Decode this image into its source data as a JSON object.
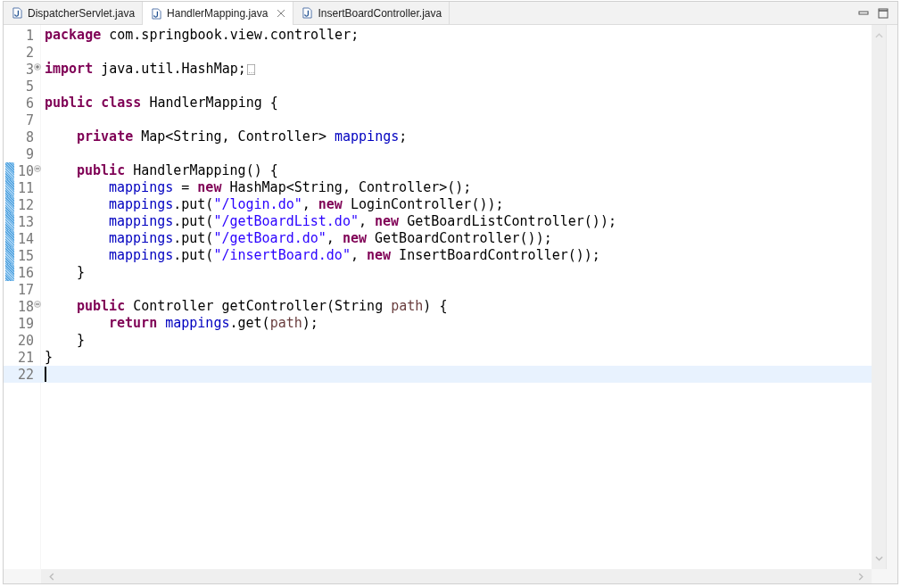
{
  "tabs": [
    {
      "label": "DispatcherServlet.java",
      "selected": false
    },
    {
      "label": "HandlerMapping.java",
      "selected": true
    },
    {
      "label": "InsertBoardController.java",
      "selected": false
    }
  ],
  "lines": [
    {
      "number": "1",
      "changed": false,
      "current": false,
      "tokens": [
        {
          "kind": "kw",
          "text": "package"
        },
        {
          "kind": "plain",
          "text": " com.springbook.view.controller;"
        }
      ]
    },
    {
      "number": "2",
      "changed": false,
      "current": false
    },
    {
      "number": "3",
      "changed": false,
      "current": false,
      "fold": {
        "collapsed": true
      },
      "tokens": [
        {
          "kind": "kw",
          "text": "import"
        },
        {
          "kind": "plain",
          "text": " java.util.HashMap;"
        }
      ]
    },
    {
      "number": "5",
      "changed": false,
      "current": false
    },
    {
      "number": "6",
      "changed": false,
      "current": false,
      "tokens": [
        {
          "kind": "kw",
          "text": "public class"
        },
        {
          "kind": "plain",
          "text": " HandlerMapping {"
        }
      ],
      "children": [
        {
          "number": "7",
          "changed": false,
          "current": false
        },
        {
          "number": "8",
          "changed": false,
          "current": false,
          "tokens": [
            {
              "kind": "kw",
              "text": "private"
            },
            {
              "kind": "plain",
              "text": " Map<String, Controller> "
            },
            {
              "kind": "field",
              "text": "mappings"
            },
            {
              "kind": "plain",
              "text": ";"
            }
          ]
        },
        {
          "number": "9",
          "changed": false,
          "current": false
        },
        {
          "number": "10",
          "changed": true,
          "current": false,
          "fold": {
            "collapsed": false
          },
          "tokens": [
            {
              "kind": "kw",
              "text": "public"
            },
            {
              "kind": "plain",
              "text": " HandlerMapping() {"
            }
          ],
          "children": [
            {
              "number": "11",
              "changed": true,
              "current": false,
              "tokens": [
                {
                  "kind": "field",
                  "text": "mappings"
                },
                {
                  "kind": "plain",
                  "text": " = "
                },
                {
                  "kind": "kw",
                  "text": "new"
                },
                {
                  "kind": "plain",
                  "text": " HashMap<String, Controller>();"
                }
              ]
            },
            {
              "number": "12",
              "changed": true,
              "current": false,
              "tokens": [
                {
                  "kind": "field",
                  "text": "mappings"
                },
                {
                  "kind": "plain",
                  "text": ".put("
                },
                {
                  "kind": "str",
                  "text": "\"/login.do\""
                },
                {
                  "kind": "plain",
                  "text": ", "
                },
                {
                  "kind": "kw",
                  "text": "new"
                },
                {
                  "kind": "plain",
                  "text": " LoginController());"
                }
              ]
            },
            {
              "number": "13",
              "changed": true,
              "current": false,
              "tokens": [
                {
                  "kind": "field",
                  "text": "mappings"
                },
                {
                  "kind": "plain",
                  "text": ".put("
                },
                {
                  "kind": "str",
                  "text": "\"/getBoardList.do\""
                },
                {
                  "kind": "plain",
                  "text": ", "
                },
                {
                  "kind": "kw",
                  "text": "new"
                },
                {
                  "kind": "plain",
                  "text": " GetBoardListController());"
                }
              ]
            },
            {
              "number": "14",
              "changed": true,
              "current": false,
              "tokens": [
                {
                  "kind": "field",
                  "text": "mappings"
                },
                {
                  "kind": "plain",
                  "text": ".put("
                },
                {
                  "kind": "str",
                  "text": "\"/getBoard.do\""
                },
                {
                  "kind": "plain",
                  "text": ", "
                },
                {
                  "kind": "kw",
                  "text": "new"
                },
                {
                  "kind": "plain",
                  "text": " GetBoardController());"
                }
              ]
            },
            {
              "number": "15",
              "changed": true,
              "current": false,
              "tokens": [
                {
                  "kind": "field",
                  "text": "mappings"
                },
                {
                  "kind": "plain",
                  "text": ".put("
                },
                {
                  "kind": "str",
                  "text": "\"/insertBoard.do\""
                },
                {
                  "kind": "plain",
                  "text": ", "
                },
                {
                  "kind": "kw",
                  "text": "new"
                },
                {
                  "kind": "plain",
                  "text": " InsertBoardController());"
                }
              ]
            }
          ]
        },
        {
          "number": "16",
          "changed": true,
          "current": false,
          "tokens": [
            {
              "kind": "plain",
              "text": "}"
            }
          ]
        },
        {
          "number": "17",
          "changed": false,
          "current": false
        },
        {
          "number": "18",
          "changed": false,
          "current": false,
          "fold": {
            "collapsed": false
          },
          "tokens": [
            {
              "kind": "kw",
              "text": "public"
            },
            {
              "kind": "plain",
              "text": " Controller getController(String "
            },
            {
              "kind": "param",
              "text": "path"
            },
            {
              "kind": "plain",
              "text": ") {"
            }
          ],
          "children": [
            {
              "number": "19",
              "changed": false,
              "current": false,
              "tokens": [
                {
                  "kind": "kw",
                  "text": "return"
                },
                {
                  "kind": "field",
                  "text": " mappings"
                },
                {
                  "kind": "plain",
                  "text": ".get("
                },
                {
                  "kind": "param",
                  "text": "path"
                },
                {
                  "kind": "plain",
                  "text": ");"
                }
              ]
            }
          ]
        },
        {
          "number": "20",
          "changed": false,
          "current": false,
          "tokens": [
            {
              "kind": "plain",
              "text": "}"
            }
          ]
        }
      ]
    },
    {
      "number": "21",
      "changed": false,
      "current": false,
      "tokens": [
        {
          "kind": "plain",
          "text": "}"
        }
      ]
    },
    {
      "number": "22",
      "changed": false,
      "current": true
    }
  ]
}
